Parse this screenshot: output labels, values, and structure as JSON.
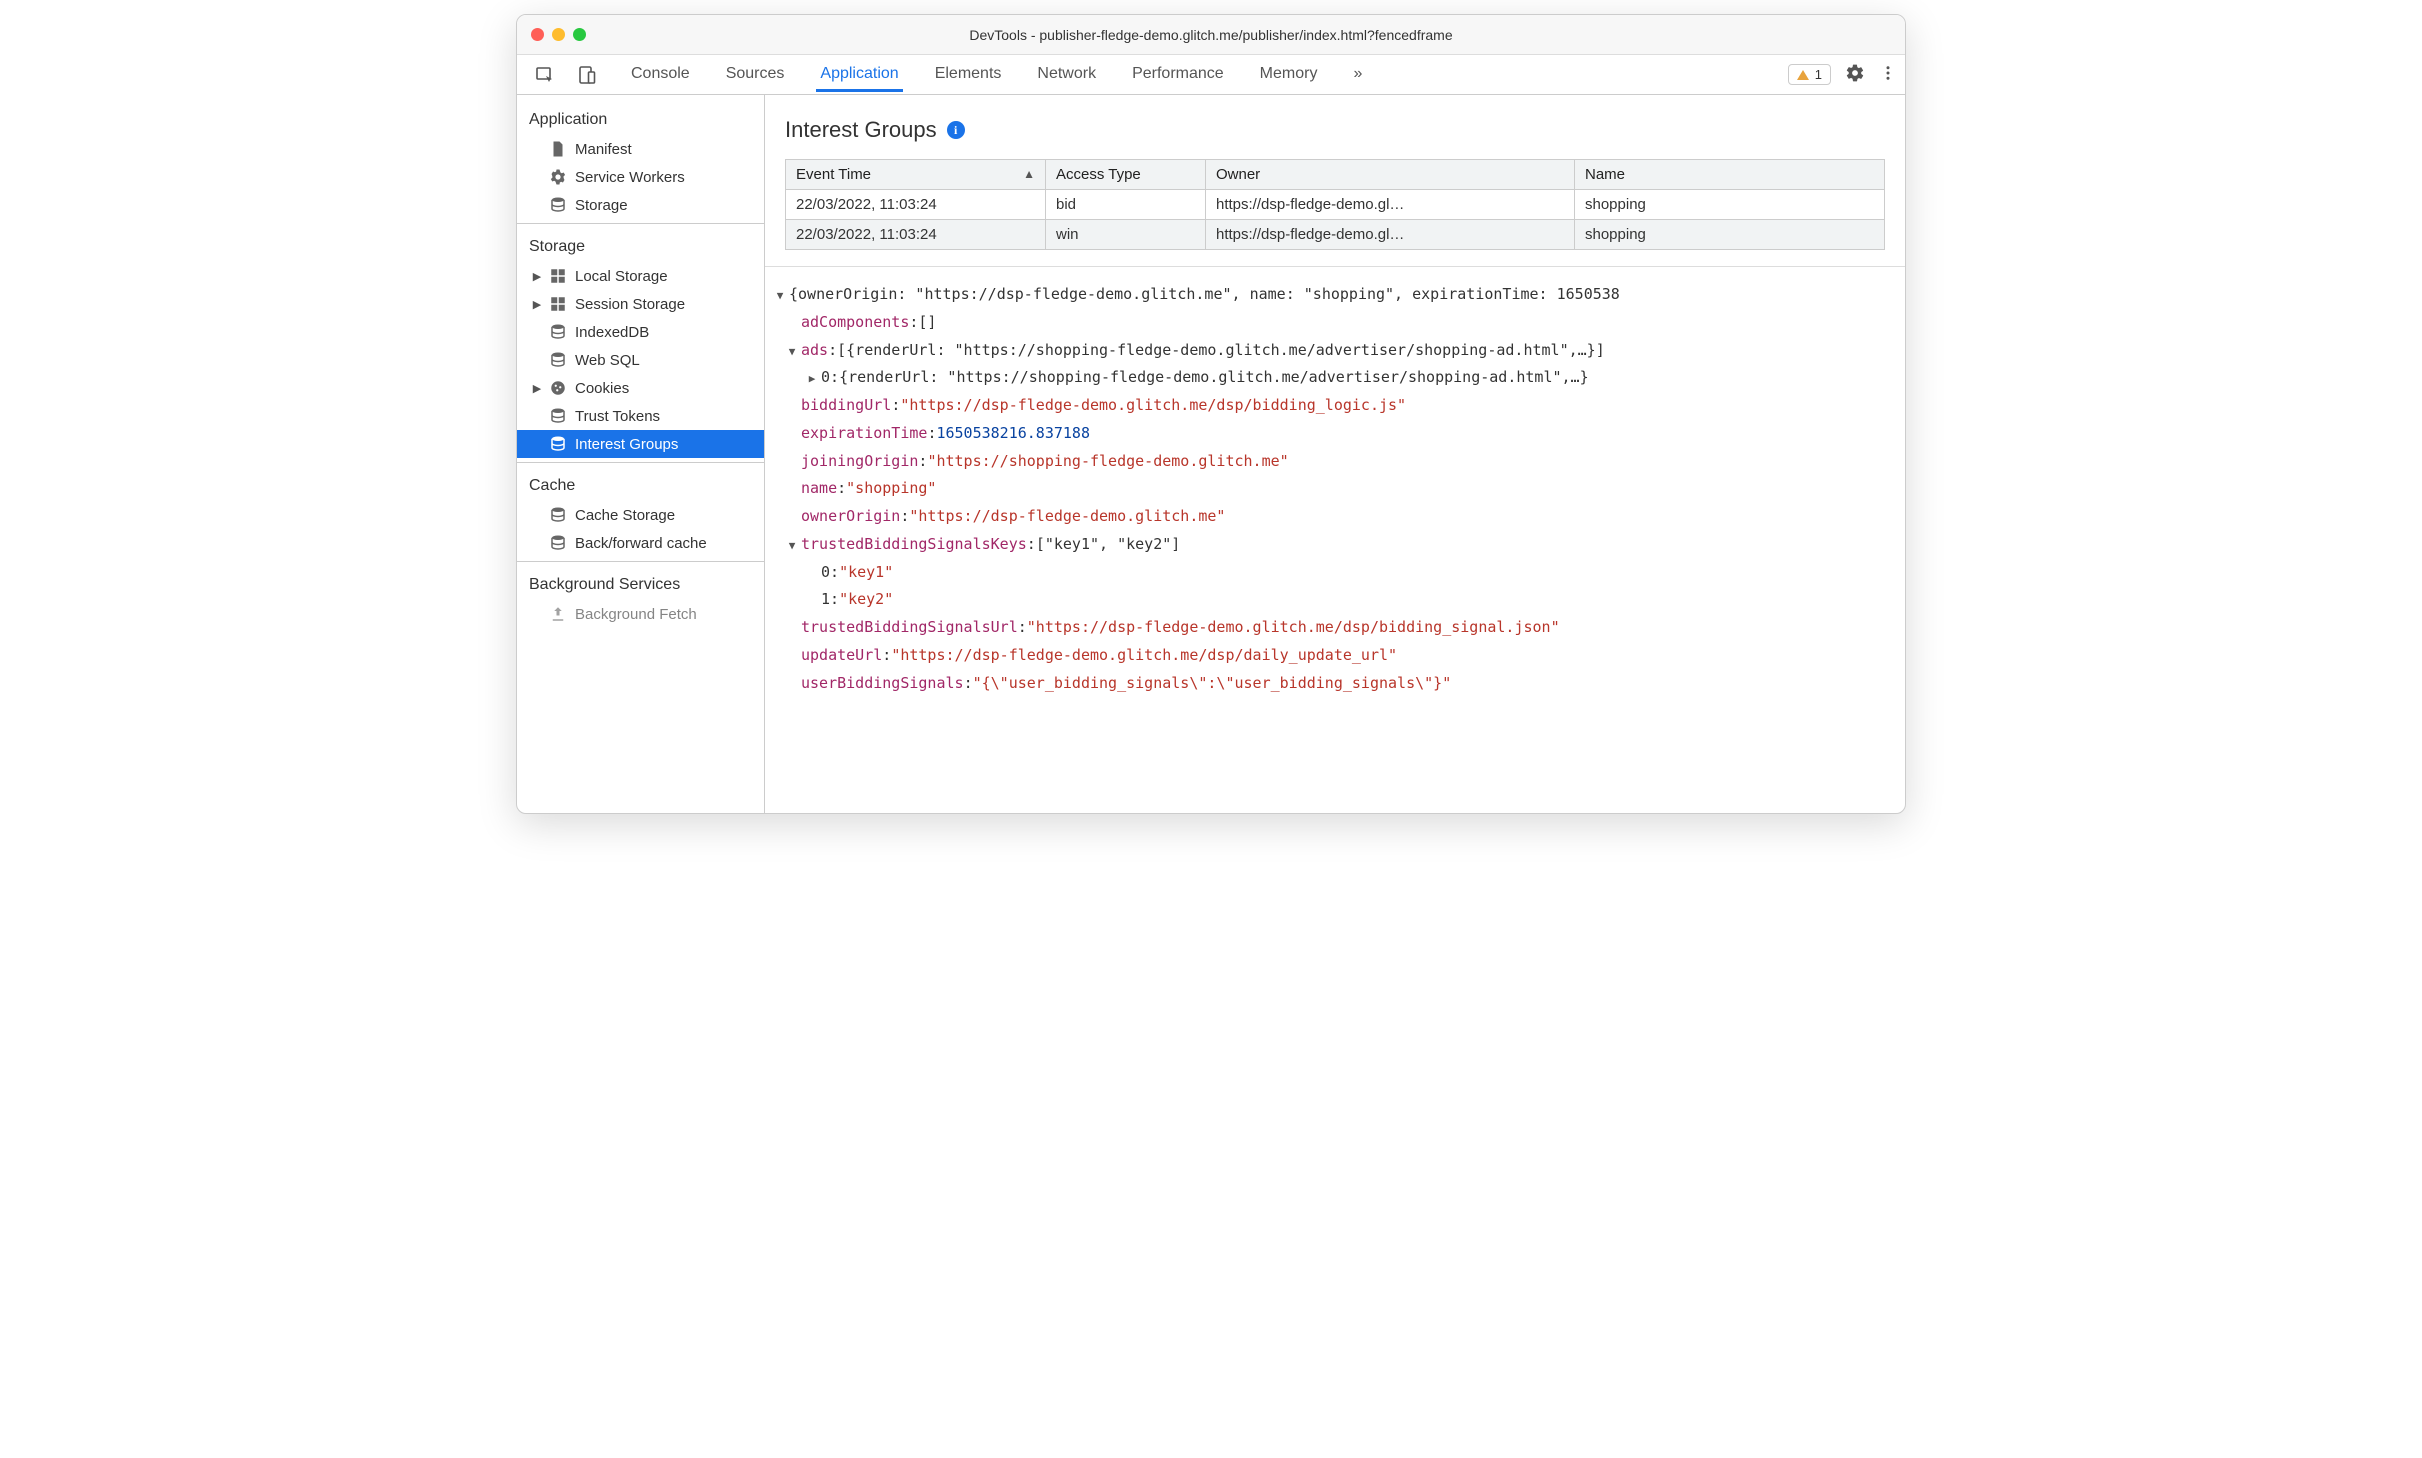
{
  "window_title": "DevTools - publisher-fledge-demo.glitch.me/publisher/index.html?fencedframe",
  "warning_count": "1",
  "tabs": {
    "console": "Console",
    "sources": "Sources",
    "application": "Application",
    "elements": "Elements",
    "network": "Network",
    "performance": "Performance",
    "memory": "Memory",
    "more": "»"
  },
  "sidebar": {
    "application": {
      "header": "Application",
      "manifest": "Manifest",
      "service_workers": "Service Workers",
      "storage": "Storage"
    },
    "storage": {
      "header": "Storage",
      "local_storage": "Local Storage",
      "session_storage": "Session Storage",
      "indexeddb": "IndexedDB",
      "web_sql": "Web SQL",
      "cookies": "Cookies",
      "trust_tokens": "Trust Tokens",
      "interest_groups": "Interest Groups"
    },
    "cache": {
      "header": "Cache",
      "cache_storage": "Cache Storage",
      "bf_cache": "Back/forward cache"
    },
    "background": {
      "header": "Background Services",
      "bg_fetch": "Background Fetch"
    }
  },
  "panel": {
    "title": "Interest Groups",
    "cols": {
      "event_time": "Event Time",
      "access_type": "Access Type",
      "owner": "Owner",
      "name": "Name"
    },
    "rows": [
      {
        "time": "22/03/2022, 11:03:24",
        "access": "bid",
        "owner": "https://dsp-fledge-demo.gl…",
        "name": "shopping"
      },
      {
        "time": "22/03/2022, 11:03:24",
        "access": "win",
        "owner": "https://dsp-fledge-demo.gl…",
        "name": "shopping"
      }
    ]
  },
  "detail": {
    "header_line": "{ownerOrigin: \"https://dsp-fledge-demo.glitch.me\", name: \"shopping\", expirationTime: 1650538",
    "adComponents_key": "adComponents",
    "adComponents_val": "[]",
    "ads_key": "ads",
    "ads_val": "[{renderUrl: \"https://shopping-fledge-demo.glitch.me/advertiser/shopping-ad.html\",…}]",
    "ads0_key": "0",
    "ads0_val": "{renderUrl: \"https://shopping-fledge-demo.glitch.me/advertiser/shopping-ad.html\",…}",
    "biddingUrl_key": "biddingUrl",
    "biddingUrl_val": "\"https://dsp-fledge-demo.glitch.me/dsp/bidding_logic.js\"",
    "expirationTime_key": "expirationTime",
    "expirationTime_val": "1650538216.837188",
    "joiningOrigin_key": "joiningOrigin",
    "joiningOrigin_val": "\"https://shopping-fledge-demo.glitch.me\"",
    "name_key": "name",
    "name_val": "\"shopping\"",
    "ownerOrigin_key": "ownerOrigin",
    "ownerOrigin_val": "\"https://dsp-fledge-demo.glitch.me\"",
    "tbk_key": "trustedBiddingSignalsKeys",
    "tbk_val": "[\"key1\", \"key2\"]",
    "tbk0_key": "0",
    "tbk0_val": "\"key1\"",
    "tbk1_key": "1",
    "tbk1_val": "\"key2\"",
    "tbu_key": "trustedBiddingSignalsUrl",
    "tbu_val": "\"https://dsp-fledge-demo.glitch.me/dsp/bidding_signal.json\"",
    "updateUrl_key": "updateUrl",
    "updateUrl_val": "\"https://dsp-fledge-demo.glitch.me/dsp/daily_update_url\"",
    "ubs_key": "userBiddingSignals",
    "ubs_val": "\"{\\\"user_bidding_signals\\\":\\\"user_bidding_signals\\\"}\""
  }
}
